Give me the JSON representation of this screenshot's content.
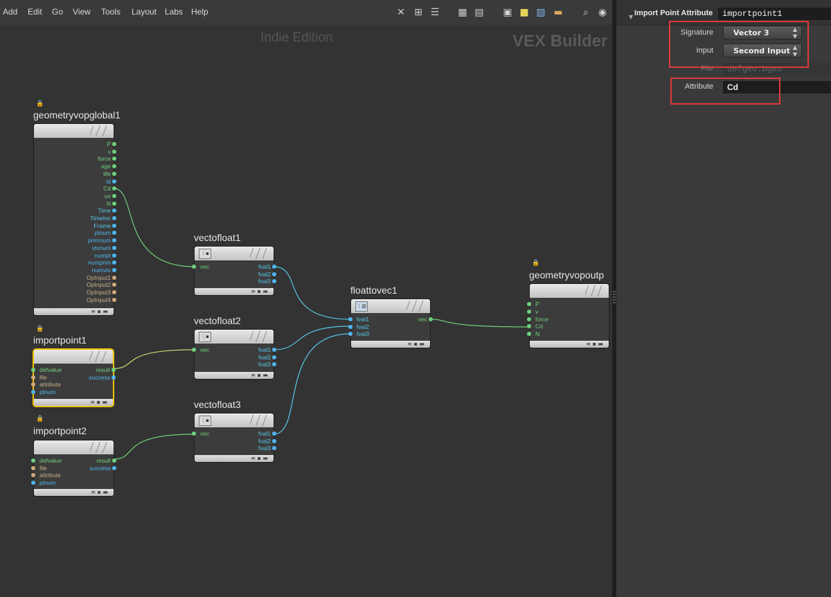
{
  "menu": [
    "Add",
    "Edit",
    "Go",
    "View",
    "Tools",
    "Layout",
    "Labs",
    "Help"
  ],
  "toolbar_icons": [
    "tools-icon",
    "tree-icon",
    "list-icon",
    "grid-icon",
    "detail-icon",
    "network-icon",
    "sticky-note-icon",
    "image-icon",
    "box-icon",
    "magnifier-icon",
    "eye-icon"
  ],
  "watermark": {
    "edition": "Indie Edition",
    "context": "VEX Builder"
  },
  "nodes": {
    "global": {
      "name": "geometryvopglobal1",
      "outputs": [
        {
          "label": "P",
          "color": "green"
        },
        {
          "label": "v",
          "color": "green"
        },
        {
          "label": "force",
          "color": "green"
        },
        {
          "label": "age",
          "color": "green"
        },
        {
          "label": "life",
          "color": "green"
        },
        {
          "label": "id",
          "color": "blue"
        },
        {
          "label": "Cd",
          "color": "green"
        },
        {
          "label": "uv",
          "color": "green"
        },
        {
          "label": "N",
          "color": "green"
        },
        {
          "label": "Time",
          "color": "cyan"
        },
        {
          "label": "TimeInc",
          "color": "cyan"
        },
        {
          "label": "Frame",
          "color": "cyan"
        },
        {
          "label": "ptnum",
          "color": "blue"
        },
        {
          "label": "primnum",
          "color": "blue"
        },
        {
          "label": "vtxnum",
          "color": "blue"
        },
        {
          "label": "numpt",
          "color": "blue"
        },
        {
          "label": "numprim",
          "color": "blue"
        },
        {
          "label": "numvtx",
          "color": "blue"
        },
        {
          "label": "OpInput1",
          "color": "tan"
        },
        {
          "label": "OpInput2",
          "color": "tan"
        },
        {
          "label": "OpInput3",
          "color": "tan"
        },
        {
          "label": "OpInput4",
          "color": "tan"
        }
      ],
      "corner": "Cd"
    },
    "importpoint1": {
      "name": "importpoint1",
      "inputs": [
        {
          "label": "defvalue",
          "color": "green"
        },
        {
          "label": "file",
          "color": "tan"
        },
        {
          "label": "attribute",
          "color": "tan"
        },
        {
          "label": "ptnum",
          "color": "blue"
        }
      ],
      "outputs": [
        {
          "label": "result",
          "color": "green"
        },
        {
          "label": "success",
          "color": "blue"
        }
      ],
      "corner": "Cd"
    },
    "importpoint2": {
      "name": "importpoint2",
      "inputs": [
        {
          "label": "defvalue",
          "color": "green"
        },
        {
          "label": "file",
          "color": "tan"
        },
        {
          "label": "attribute",
          "color": "tan"
        },
        {
          "label": "ptnum",
          "color": "blue"
        }
      ],
      "outputs": [
        {
          "label": "result",
          "color": "green"
        },
        {
          "label": "success",
          "color": "blue"
        }
      ]
    },
    "vectofloat1": {
      "name": "vectofloat1",
      "inputs": [
        {
          "label": "vec",
          "color": "green"
        }
      ],
      "outputs": [
        {
          "label": "fval1",
          "color": "cyan"
        },
        {
          "label": "fval2",
          "color": "cyan"
        },
        {
          "label": "fval3",
          "color": "cyan"
        }
      ]
    },
    "vectofloat2": {
      "name": "vectofloat2",
      "inputs": [
        {
          "label": "vec",
          "color": "green"
        }
      ],
      "outputs": [
        {
          "label": "fval1",
          "color": "cyan"
        },
        {
          "label": "fval2",
          "color": "cyan"
        },
        {
          "label": "fval3",
          "color": "cyan"
        }
      ]
    },
    "vectofloat3": {
      "name": "vectofloat3",
      "inputs": [
        {
          "label": "vec",
          "color": "green"
        }
      ],
      "outputs": [
        {
          "label": "fval1",
          "color": "cyan"
        },
        {
          "label": "fval2",
          "color": "cyan"
        },
        {
          "label": "fval3",
          "color": "cyan"
        }
      ]
    },
    "floattovec1": {
      "name": "floattovec1",
      "inputs": [
        {
          "label": "fval1",
          "color": "cyan"
        },
        {
          "label": "fval2",
          "color": "cyan"
        },
        {
          "label": "fval3",
          "color": "cyan"
        }
      ],
      "outputs": [
        {
          "label": "vec",
          "color": "green"
        }
      ]
    },
    "output": {
      "name": "geometryvopoutp",
      "inputs": [
        {
          "label": "P",
          "color": "green"
        },
        {
          "label": "v",
          "color": "green"
        },
        {
          "label": "force",
          "color": "green"
        },
        {
          "label": "Cd",
          "color": "green"
        },
        {
          "label": "N",
          "color": "green"
        }
      ]
    }
  },
  "parms": {
    "node_type": "Import Point Attribute",
    "node_name": "importpoint1",
    "signature_label": "Signature",
    "signature_value": "Vector 3",
    "input_label": "Input",
    "input_value": "Second Input",
    "file_label": "File",
    "file_value": "defgeo.bgeo",
    "attribute_label": "Attribute",
    "attribute_value": "Cd"
  },
  "colors": {
    "green": "#6fd17a",
    "cyan": "#56c8e8",
    "blue": "#4fb6f0",
    "tan": "#d2a87a",
    "selection": "#f2c200",
    "highlight": "#e03a3a"
  }
}
